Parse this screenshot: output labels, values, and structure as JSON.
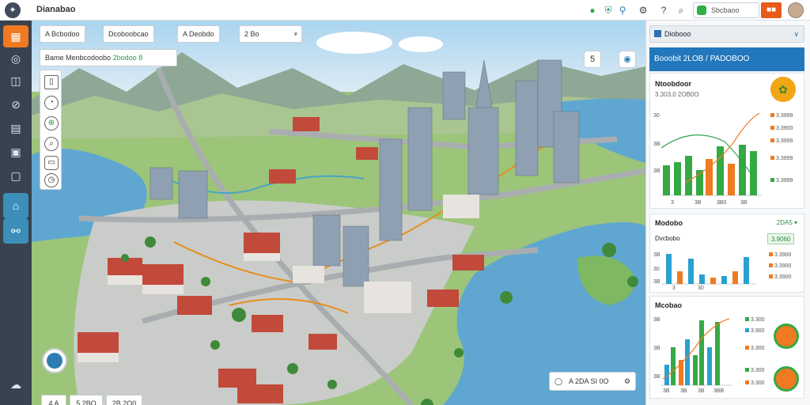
{
  "app": {
    "title": "Dianabao"
  },
  "topbar": {
    "search_text": "Sbcbaoo",
    "flag_label": "■■"
  },
  "sidebar": {
    "items": [
      {
        "icon": "calendar-icon"
      },
      {
        "icon": "globe-icon"
      },
      {
        "icon": "layers-icon"
      },
      {
        "icon": "compass-icon"
      },
      {
        "icon": "document-icon"
      },
      {
        "icon": "search-doc-icon"
      },
      {
        "icon": "clipboard-icon"
      },
      {
        "icon": "map-icon"
      },
      {
        "icon": "route-icon"
      },
      {
        "icon": "cloud-icon"
      }
    ]
  },
  "map": {
    "chips": [
      {
        "text": "A Bcbodoo"
      },
      {
        "text": "Dcoboobcao"
      },
      {
        "text": "A Deobdo"
      },
      {
        "text": "2 Bo"
      }
    ],
    "search_line": {
      "label": "Bame Menbcodoobo",
      "value": "2bodoo 8"
    },
    "fab_left": "5",
    "scale": [
      "4 A",
      "5 2BO",
      "2B 2O0"
    ],
    "status": "A 2DA SI 0O"
  },
  "panel": {
    "header": "Diobooo",
    "banner": "Booobit 2LOB / PADOBOO",
    "card1": {
      "title": "Ntoobdoor",
      "subtitle": "3.303.0 2OB0O",
      "ylabels": [
        "30",
        "3B",
        "3B"
      ],
      "xlabels": [
        "3",
        "3B",
        "3B0",
        "3B"
      ],
      "legend": [
        "3.3999",
        "3.3900",
        "3.3999",
        "3.3999",
        "3.3999"
      ]
    },
    "card2": {
      "title": "Modobo",
      "right": "2DA5 ▾",
      "subtitle": "Dvcbobo",
      "badge": "3.9060",
      "ylabels": [
        "3B",
        "30",
        "3B"
      ],
      "xlabels": [
        "3",
        "30"
      ],
      "legend": [
        "3.3900",
        "3.3900",
        "3.3900"
      ]
    },
    "card3": {
      "title": "Mcobao",
      "ylabels": [
        "3B",
        "3B",
        "3B"
      ],
      "xlabels": [
        "3B",
        "3B",
        "3B",
        "3BB"
      ],
      "legend": [
        "3.300",
        "3.900",
        "3.300",
        "3.300",
        "3.300"
      ]
    }
  }
}
